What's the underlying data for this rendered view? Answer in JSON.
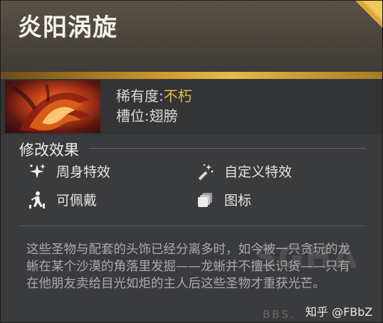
{
  "item": {
    "title": "炎阳涡旋",
    "rarity_label": "稀有度:",
    "rarity_value": "不朽",
    "slot_label": "槽位:",
    "slot_value": "翅膀"
  },
  "effects": {
    "heading": "修改效果",
    "items": [
      {
        "label": "周身特效",
        "icon": "sparkle-icon"
      },
      {
        "label": "自定义特效",
        "icon": "magic-wand-icon"
      },
      {
        "label": "可佩戴",
        "icon": "walking-figure-icon"
      },
      {
        "label": "图标",
        "icon": "stacked-cards-icon"
      }
    ]
  },
  "description": "这些圣物与配套的头饰已经分离多时，如今被一只贪玩的龙蜥在某个沙漠的角落里发掘——龙蜥并不擅长识货——只有在他朋友卖给目光如炬的主人后这些圣物才重获光芒。",
  "watermark": {
    "big": "SGHA",
    "site": "BBS.",
    "credit": "知乎 @FBbZ"
  },
  "colors": {
    "accent_gold": "#e8b84a",
    "rarity_color": "#e8b84a"
  }
}
